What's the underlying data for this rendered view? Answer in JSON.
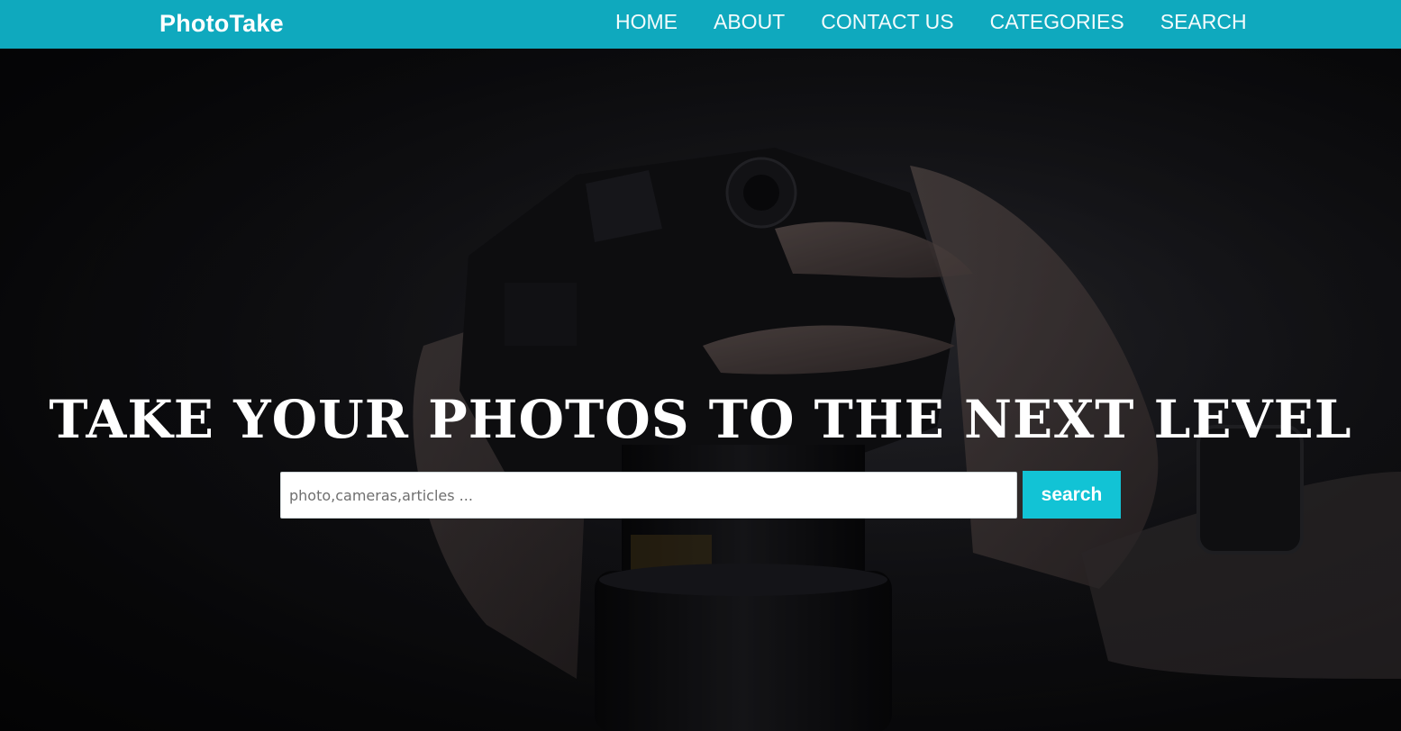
{
  "navbar": {
    "brand": "PhotoTake",
    "links": [
      "HOME",
      "ABOUT",
      "CONTACT US",
      "CATEGORIES",
      "SEARCH"
    ]
  },
  "hero": {
    "headline": "TAKE YOUR PHOTOS TO THE NEXT LEVEL",
    "search": {
      "placeholder": "photo,cameras,articles ...",
      "value": "",
      "button_label": "search"
    }
  },
  "colors": {
    "navbar_bg": "#0fa9be",
    "button_bg": "#12c3d5",
    "headline": "#ffffff"
  }
}
